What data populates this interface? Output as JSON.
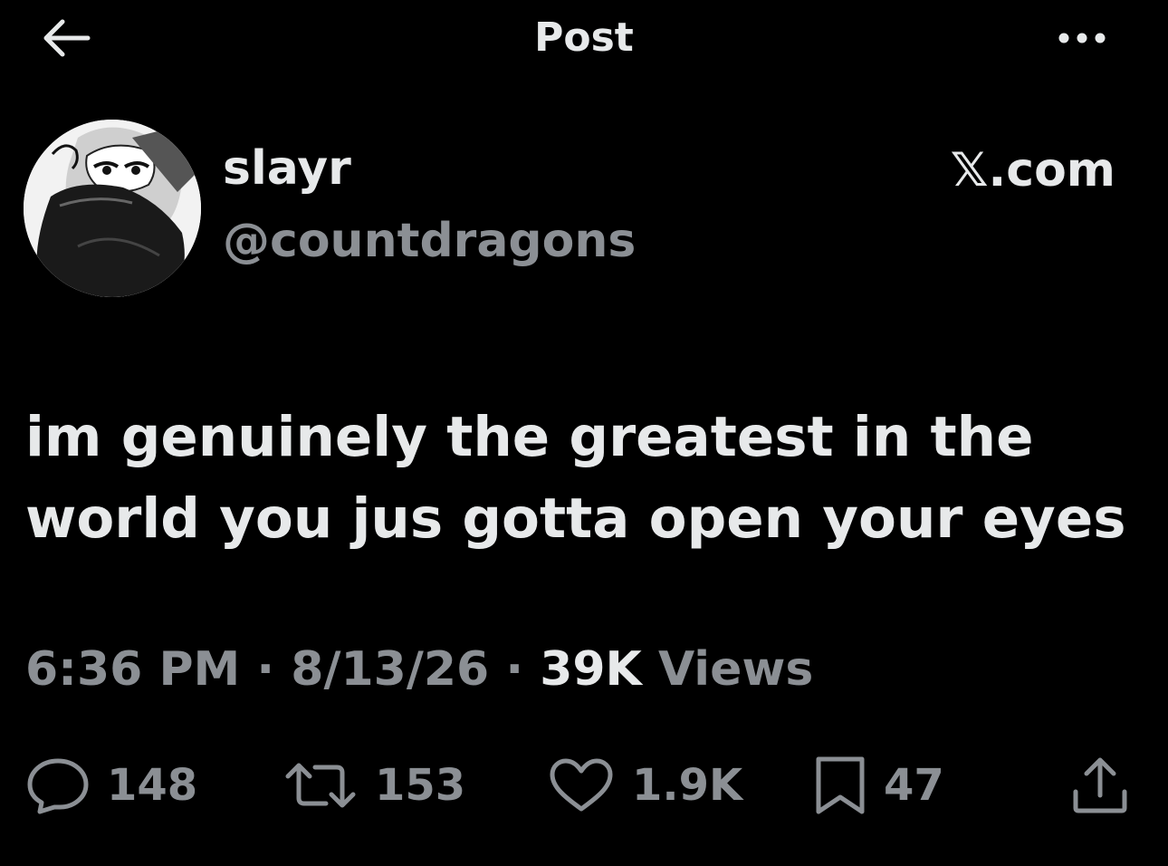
{
  "header": {
    "title": "Post",
    "back_icon": "arrow-left-icon",
    "more_icon": "more-horizontal-icon"
  },
  "author": {
    "display_name": "slayr",
    "handle": "@countdragons",
    "source": "𝕏.com"
  },
  "post": {
    "text": "im genuinely the greatest in the world you jus gotta open your eyes"
  },
  "meta": {
    "time": "6:36 PM",
    "separator": "·",
    "date": "8/13/26",
    "views_count": "39K",
    "views_label": "Views"
  },
  "actions": {
    "replies": "148",
    "reposts": "153",
    "likes": "1.9K",
    "bookmarks": "47"
  },
  "colors": {
    "background": "#000000",
    "primary_text": "#e7e9ea",
    "secondary_text": "#8b8f94"
  }
}
